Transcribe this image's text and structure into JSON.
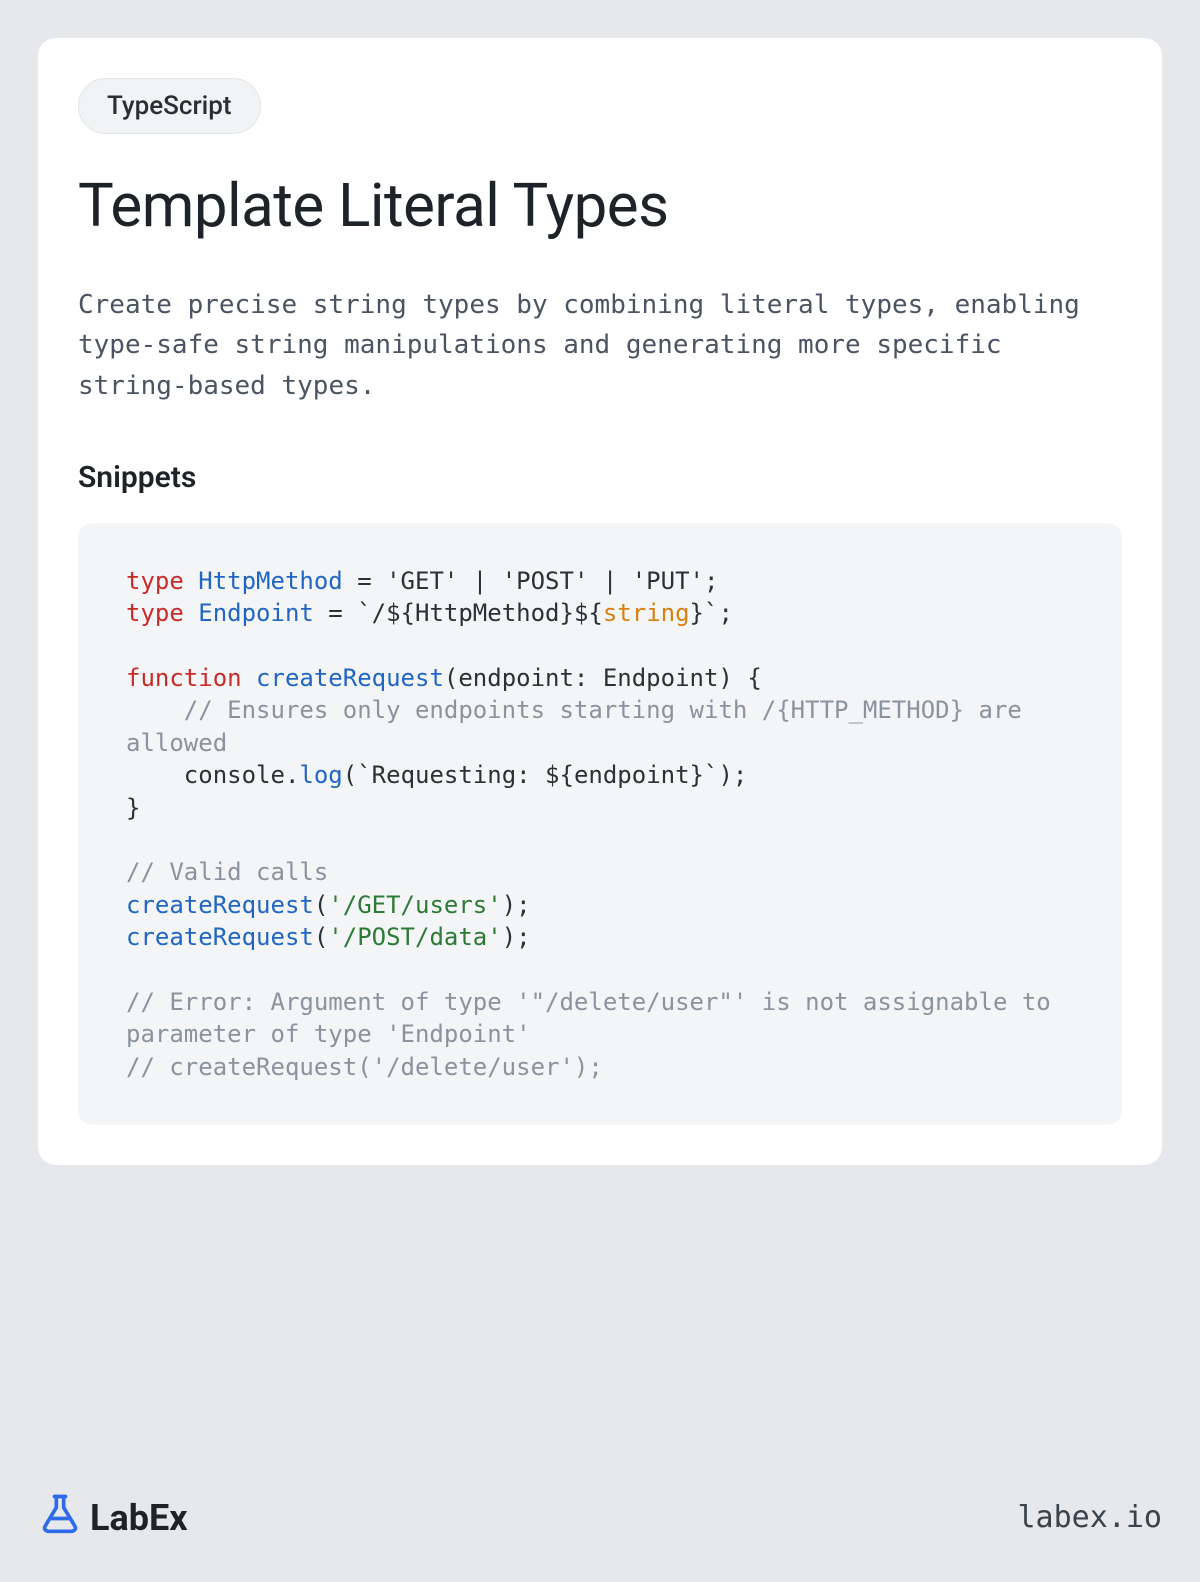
{
  "badge": "TypeScript",
  "title": "Template Literal Types",
  "description": "Create precise string types by combining literal types, enabling type-safe string manipulations and generating more specific string-based types.",
  "section_label": "Snippets",
  "code": {
    "l1": {
      "kw": "type",
      "name": "HttpMethod",
      "rest": " = 'GET' | 'POST' | 'PUT';"
    },
    "l2": {
      "kw": "type",
      "name": "Endpoint",
      "eq": " = ",
      "bt1": "`/${HttpMethod}${",
      "strkw": "string",
      "bt2": "}`",
      "semi": ";"
    },
    "l3": "",
    "l4": {
      "kw": "function",
      "fn": "createRequest",
      "sig": "(endpoint: Endpoint) {"
    },
    "l5": {
      "cm": "    // Ensures only endpoints starting with /{HTTP_METHOD} are allowed"
    },
    "l6": {
      "ind": "    ",
      "obj": "console",
      "dot": ".",
      "mth": "log",
      "open": "(",
      "tpl": "`Requesting: ${endpoint}`",
      "close": ");"
    },
    "l7": "}",
    "l8": "",
    "l9": {
      "cm": "// Valid calls"
    },
    "l10": {
      "fn": "createRequest",
      "open": "(",
      "str": "'/GET/users'",
      "close": ");"
    },
    "l11": {
      "fn": "createRequest",
      "open": "(",
      "str": "'/POST/data'",
      "close": ");"
    },
    "l12": "",
    "l13": {
      "cm": "// Error: Argument of type '\"/delete/user\"' is not assignable to parameter of type 'Endpoint'"
    },
    "l14": {
      "cm": "// createRequest('/delete/user');"
    }
  },
  "logo_text": "LabEx",
  "site": "labex.io"
}
